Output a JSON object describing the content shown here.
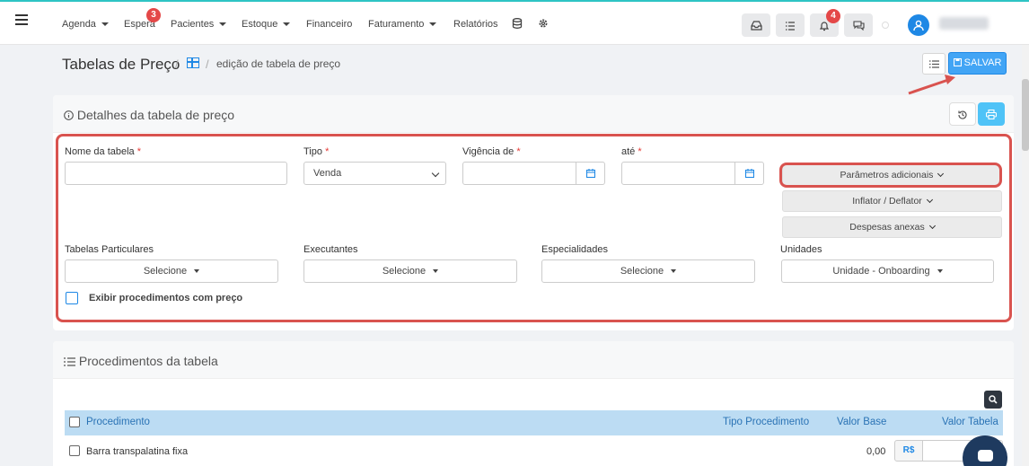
{
  "nav": {
    "items": [
      {
        "label": "Agenda",
        "dropdown": true
      },
      {
        "label": "Espera",
        "badge": "3"
      },
      {
        "label": "Pacientes",
        "dropdown": true
      },
      {
        "label": "Estoque",
        "dropdown": true
      },
      {
        "label": "Financeiro"
      },
      {
        "label": "Faturamento",
        "dropdown": true
      },
      {
        "label": "Relatórios"
      }
    ],
    "notification_badge": "4"
  },
  "breadcrumb": {
    "title": "Tabelas de Preço",
    "separator": "/",
    "current": "edição de tabela de preço"
  },
  "toolbar": {
    "save_label": "SALVAR"
  },
  "details": {
    "title": "Detalhes da tabela de preço",
    "fields": {
      "name_label": "Nome da tabela",
      "type_label": "Tipo",
      "type_value": "Venda",
      "from_label": "Vigência de",
      "to_label": "até",
      "required_mark": "*"
    },
    "buttons": {
      "params": "Parâmetros adicionais",
      "inflator": "Inflator / Deflator",
      "expenses": "Despesas anexas"
    },
    "selects": [
      {
        "label": "Tabelas Particulares",
        "value": "Selecione"
      },
      {
        "label": "Executantes",
        "value": "Selecione"
      },
      {
        "label": "Especialidades",
        "value": "Selecione"
      },
      {
        "label": "Unidades",
        "value": "Unidade - Onboarding"
      }
    ],
    "checkbox_label": "Exibir procedimentos com preço"
  },
  "procedures": {
    "title": "Procedimentos da tabela",
    "columns": [
      "Procedimento",
      "Tipo Procedimento",
      "Valor Base",
      "Valor Tabela"
    ],
    "rows": [
      {
        "name": "Barra transpalatina fixa",
        "base": "0,00",
        "currency": "R$"
      }
    ]
  },
  "colors": {
    "primary": "#1e88e5",
    "highlight": "#d9534f",
    "header_bg": "#bcdcf3",
    "badge": "#e44848"
  }
}
